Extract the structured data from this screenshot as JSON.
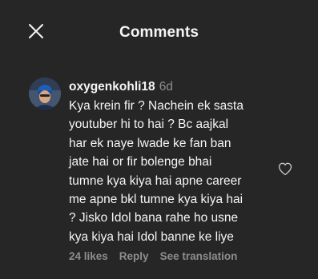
{
  "header": {
    "title": "Comments",
    "close_icon": "close-icon"
  },
  "comment": {
    "username": "oxygenkohli18",
    "time": "6d",
    "text_lines": [
      "Kya krein fir ? Nachein ek sasta",
      "youtuber hi to hai ? Bc aajkal",
      "har ek naye lwade ke fan ban",
      "jate hai or fir bolenge bhai",
      "tumne kya kiya hai apne career",
      "me apne bkl tumne kya kiya hai",
      "? Jisko Idol bana rahe ho usne",
      "kya kiya hai Idol banne ke liye"
    ],
    "likes": "24 likes",
    "reply_label": "Reply",
    "translation_label": "See translation",
    "like_icon": "heart-icon"
  },
  "colors": {
    "background": "#262626",
    "text_primary": "#f5f5f5",
    "text_secondary": "#8e8e8e"
  }
}
